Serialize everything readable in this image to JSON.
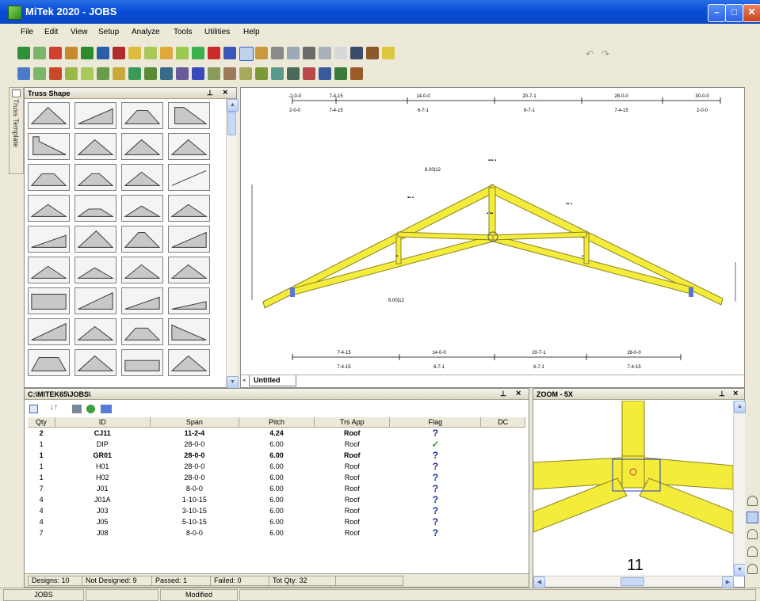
{
  "window": {
    "title": "MiTek 2020 - JOBS",
    "min_glyph": "–",
    "max_glyph": "□",
    "close_glyph": "✕"
  },
  "menu": [
    "File",
    "Edit",
    "View",
    "Setup",
    "Analyze",
    "Tools",
    "Utilities",
    "Help"
  ],
  "toolbar": {
    "undo_glyph": "↶",
    "redo_glyph": "↷"
  },
  "left_tab": {
    "label": "Truss Template"
  },
  "shape_panel": {
    "title": "Truss Shape",
    "pin": "⊥",
    "close": "×"
  },
  "drawing": {
    "tab_label": "Untitled",
    "top_dims_row1": [
      "-2-0-0",
      "7-4-15",
      "14-0-0",
      "20-7-1",
      "28-0-0",
      "30-0-0"
    ],
    "top_dims_row2": [
      "2-0-0",
      "7-4-15",
      "6-7-1",
      "6-7-1",
      "7-4-15",
      "2-0-0"
    ],
    "bottom_dims_row1": [
      "7-4-15",
      "14-0-0",
      "20-7-1",
      "28-0-0"
    ],
    "bottom_dims_row2": [
      "7-4-15",
      "6-7-1",
      "6-7-1",
      "7-4-15"
    ],
    "pitch_labels": [
      "6.00|12",
      "6.00|12"
    ]
  },
  "job_panel": {
    "path": "C:\\MITEK65\\JOBS\\",
    "columns": [
      "Qty",
      "ID",
      "Span",
      "Pitch",
      "Trs App",
      "Flag",
      "DC"
    ],
    "rows": [
      {
        "qty": "2",
        "id": "CJ11",
        "span": "11-2-4",
        "pitch": "4.24",
        "app": "Roof",
        "flag": "?",
        "bold": true
      },
      {
        "qty": "1",
        "id": "DIP",
        "span": "28-0-0",
        "pitch": "6.00",
        "app": "Roof",
        "flag": "✓",
        "bold": false
      },
      {
        "qty": "1",
        "id": "GR01",
        "span": "28-0-0",
        "pitch": "6.00",
        "app": "Roof",
        "flag": "?",
        "bold": true
      },
      {
        "qty": "1",
        "id": "H01",
        "span": "28-0-0",
        "pitch": "6.00",
        "app": "Roof",
        "flag": "?",
        "bold": false
      },
      {
        "qty": "1",
        "id": "H02",
        "span": "28-0-0",
        "pitch": "6.00",
        "app": "Roof",
        "flag": "?",
        "bold": false
      },
      {
        "qty": "7",
        "id": "J01",
        "span": "8-0-0",
        "pitch": "6.00",
        "app": "Roof",
        "flag": "?",
        "bold": false
      },
      {
        "qty": "4",
        "id": "J01A",
        "span": "1-10-15",
        "pitch": "6.00",
        "app": "Roof",
        "flag": "?",
        "bold": false
      },
      {
        "qty": "4",
        "id": "J03",
        "span": "3-10-15",
        "pitch": "6.00",
        "app": "Roof",
        "flag": "?",
        "bold": false
      },
      {
        "qty": "4",
        "id": "J05",
        "span": "5-10-15",
        "pitch": "6.00",
        "app": "Roof",
        "flag": "?",
        "bold": false
      },
      {
        "qty": "7",
        "id": "J08",
        "span": "8-0-0",
        "pitch": "6.00",
        "app": "Roof",
        "flag": "?",
        "bold": false
      }
    ],
    "summary": {
      "designs": "Designs: 10",
      "not_designed": "Not Designed: 9",
      "passed": "Passed: 1",
      "failed": "Failed: 0",
      "tot_qty": "Tot Qty: 32"
    }
  },
  "zoom_panel": {
    "title": "ZOOM - 5X",
    "joint_number": "11"
  },
  "statusbar": {
    "left": "JOBS",
    "middle": "Modified"
  },
  "colors": {
    "truss_fill": "#f4ec3a",
    "truss_stroke": "#8a8220",
    "accent": "#0a4ed6"
  }
}
